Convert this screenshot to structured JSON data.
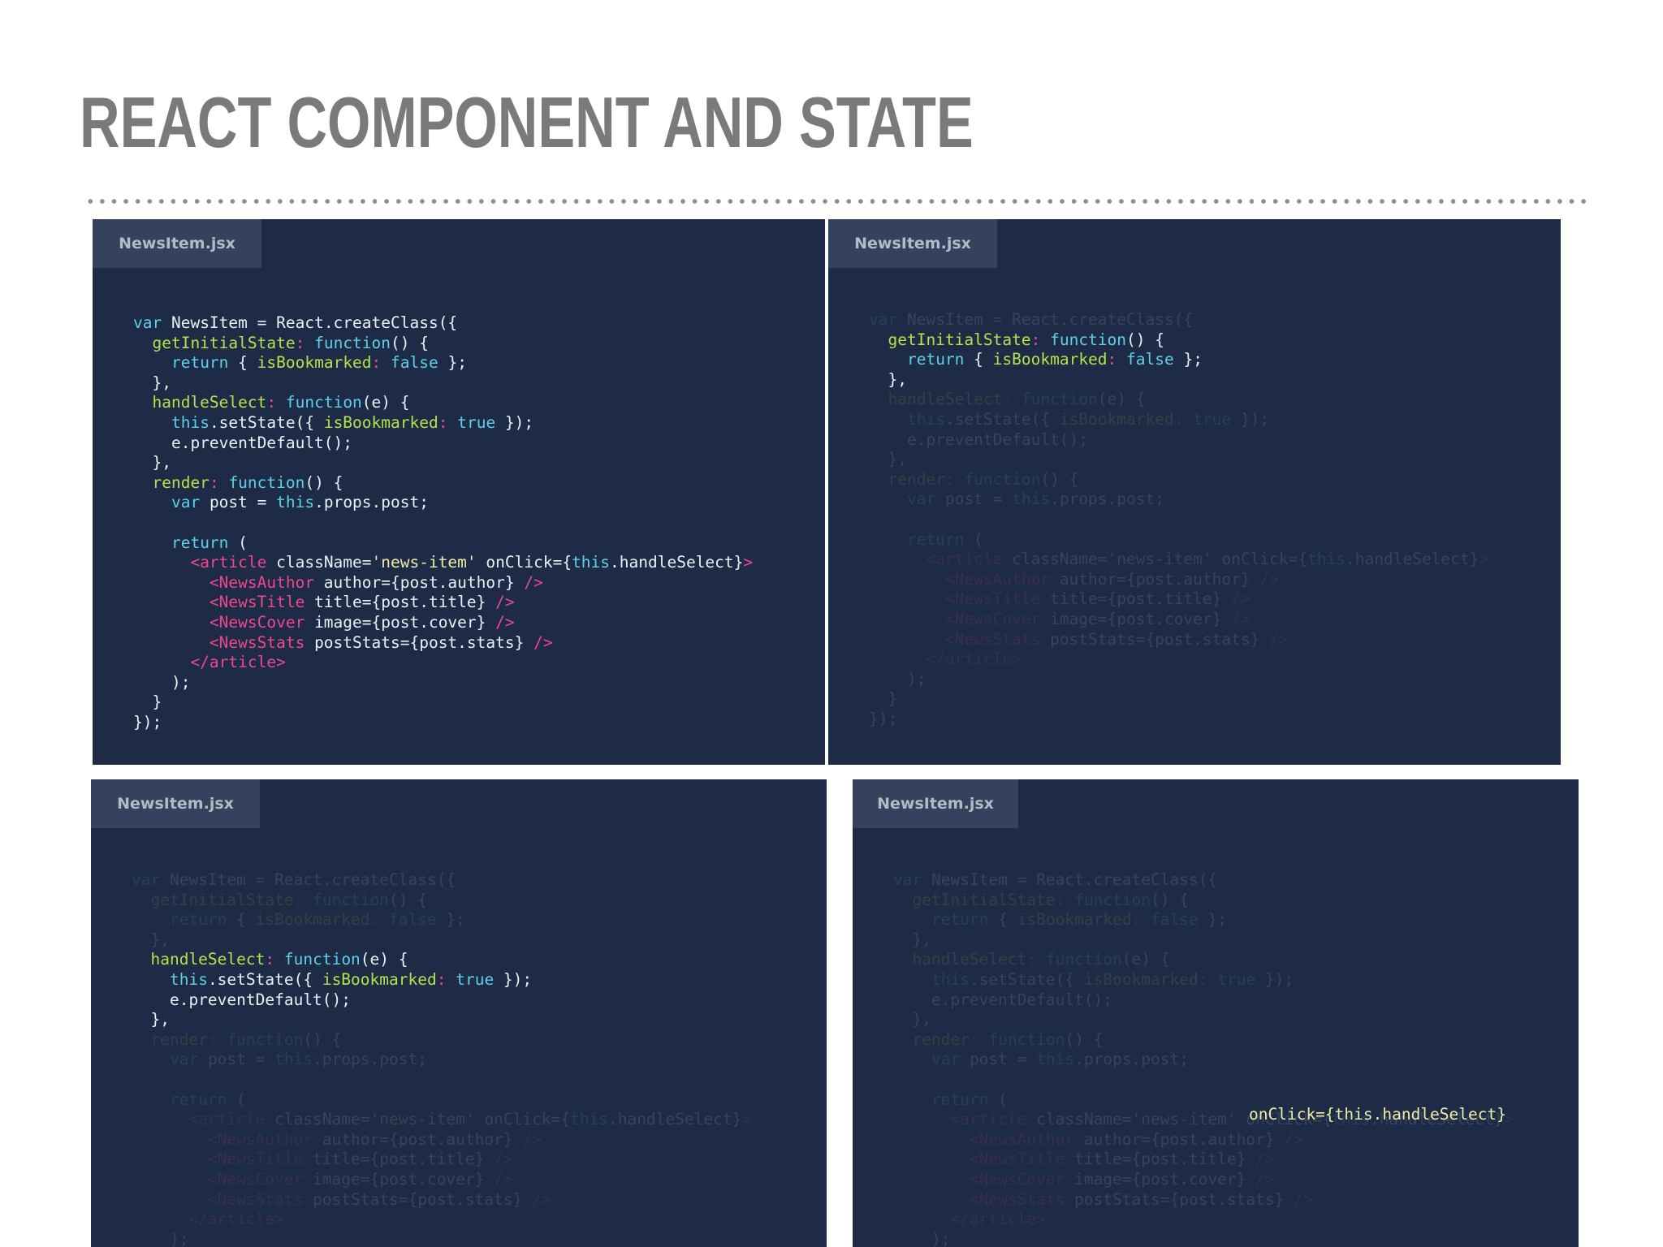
{
  "slide": {
    "title": "REACT COMPONENT AND STATE"
  },
  "panels": [
    {
      "tab": "NewsItem.jsx"
    },
    {
      "tab": "NewsItem.jsx"
    },
    {
      "tab": "NewsItem.jsx"
    },
    {
      "tab": "NewsItem.jsx"
    }
  ],
  "code_lines": [
    "var NewsItem = React.createClass({",
    "  getInitialState: function() {",
    "    return { isBookmarked: false };",
    "  },",
    "  handleSelect: function(e) {",
    "    this.setState({ isBookmarked: true });",
    "    e.preventDefault();",
    "  },",
    "  render: function() {",
    "    var post = this.props.post;",
    "",
    "    return (",
    "      <article className='news-item' onClick={this.handleSelect}>",
    "        <NewsAuthor author={post.author} />",
    "        <NewsTitle title={post.title} />",
    "        <NewsCover image={post.cover} />",
    "        <NewsStats postStats={post.stats} />",
    "      </article>",
    "    );",
    "  }",
    "});"
  ],
  "highlight_fragment": "onClick={this.handleSelect}",
  "colors": {
    "panel_bg": "#1d2b46",
    "tab_bg": "#34425d",
    "keyword": "#5fd0e8",
    "property": "#b4e24a",
    "jsx_tag": "#f0478c",
    "string": "#f0eca8"
  }
}
